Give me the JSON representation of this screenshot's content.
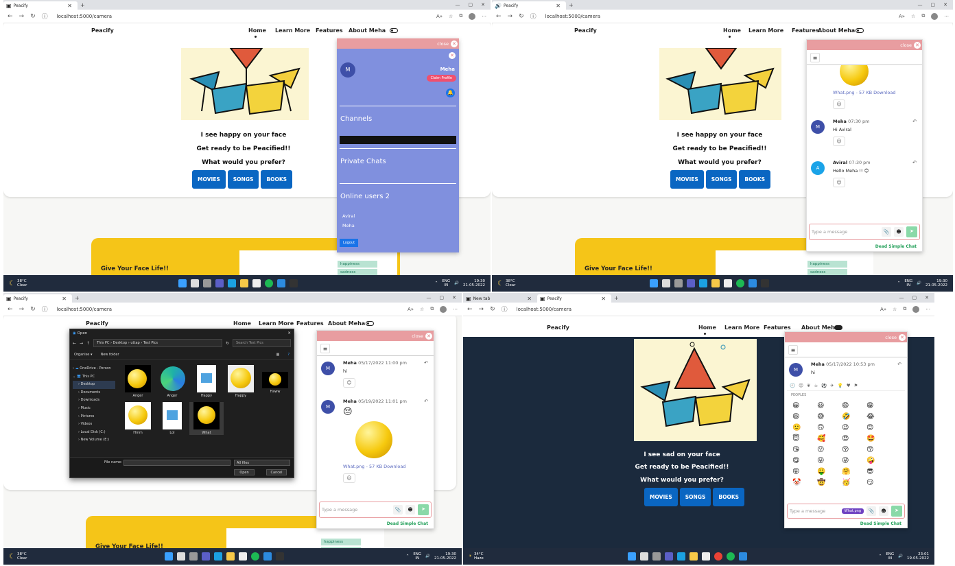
{
  "browser": {
    "tab_title": "Peacify",
    "url": "localhost:5000/camera",
    "new_tab_title": "New tab"
  },
  "nav": {
    "brand": "Peacify",
    "home": "Home",
    "learn": "Learn More",
    "features": "Features",
    "about": "About Meha"
  },
  "hero": {
    "happy": "I see happy on your face",
    "sad": "I see sad on your face",
    "ready": "Get ready to be Peacified!!",
    "prefer": "What would you prefer?"
  },
  "buttons": {
    "movies": "MOVIES",
    "songs": "SONGS",
    "books": "BOOKS"
  },
  "yellow": {
    "text": "Give Your Face Life!!"
  },
  "tags": [
    "happiness",
    "sadness"
  ],
  "chat": {
    "close": "close",
    "placeholder": "Type a message",
    "brand": "Dead Simple Chat",
    "profile": {
      "initial": "M",
      "name": "Meha",
      "claim": "Claim Profile"
    },
    "sidebar": {
      "channels": "Channels",
      "private": "Private Chats",
      "online": "Online users 2",
      "users": [
        "Aviral",
        "Meha"
      ],
      "logout": "Logout"
    },
    "pane2": [
      {
        "file": "What.png - 57 KB Download"
      },
      {
        "initial": "M",
        "name": "Meha",
        "time": "07:30 pm",
        "text": "Hi Aviral"
      },
      {
        "initial": "A",
        "name": "Aviral",
        "time": "07:30 pm",
        "text": "Hello Meha !! 😊"
      }
    ],
    "pane3": [
      {
        "initial": "M",
        "name": "Meha",
        "time": "05/17/2022 11:00 pm",
        "text": "hi"
      },
      {
        "initial": "M",
        "name": "Meha",
        "time": "05/19/2022 11:01 pm",
        "text": "😔",
        "file": "What.png - 57 KB Download"
      }
    ],
    "pane4": [
      {
        "initial": "M",
        "name": "Meha",
        "time": "05/17/2022 10:53 pm",
        "text": "hi"
      }
    ],
    "attachment": "What.png",
    "picker_category": "PEOPLES",
    "emojis": [
      "😀",
      "😃",
      "😄",
      "😁",
      "😆",
      "😅",
      "🤣",
      "😂",
      "🙂",
      "🙃",
      "😉",
      "😊",
      "😇",
      "🥰",
      "😍",
      "🤩",
      "😘",
      "😗",
      "😚",
      "😙",
      "😋",
      "😛",
      "😜",
      "🤪",
      "😝",
      "🤑",
      "🤗",
      "😎",
      "🤡",
      "🤠",
      "🥳",
      "😏"
    ]
  },
  "dialog": {
    "title": "Open",
    "path": "This PC  ›  Desktop  ›  uttap  ›  Test Pics",
    "search": "Search Test Pics",
    "organise": "Organise ▾",
    "newfolder": "New folder",
    "tree": [
      "OneDrive - Person",
      "This PC",
      "Desktop",
      "Documents",
      "Downloads",
      "Music",
      "Pictures",
      "Videos",
      "Local Disk (C:)",
      "New Volume (E:)"
    ],
    "files": [
      "Anger",
      "Anger",
      "Happy",
      "Happy",
      "Haww",
      "Hmm",
      "Lol",
      "What"
    ],
    "filename_label": "File name:",
    "filter": "All files",
    "open": "Open",
    "cancel": "Cancel"
  },
  "taskbar": [
    {
      "temp": "38°C",
      "cond": "Clear",
      "lang": "ENG",
      "region": "IN",
      "time": "19:30",
      "date": "21-05-2022"
    },
    {
      "temp": "38°C",
      "cond": "Clear",
      "lang": "ENG",
      "region": "IN",
      "time": "19:30",
      "date": "21-05-2022"
    },
    {
      "temp": "38°C",
      "cond": "Clear",
      "lang": "ENG",
      "region": "IN",
      "time": "19:30",
      "date": "21-05-2022"
    },
    {
      "temp": "34°C",
      "cond": "Haze",
      "lang": "ENG",
      "region": "IN",
      "time": "23:01",
      "date": "19-05-2022"
    }
  ]
}
